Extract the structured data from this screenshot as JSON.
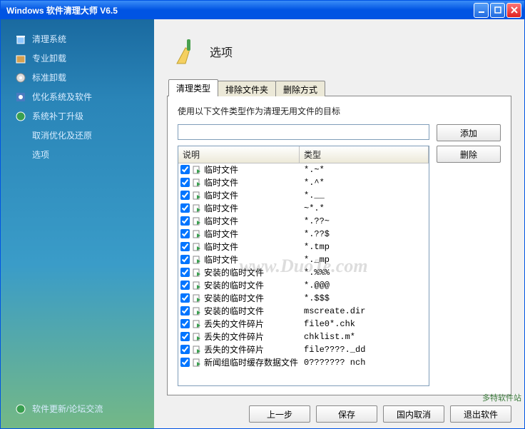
{
  "window": {
    "title": "Windows 软件清理大师 V6.5"
  },
  "sidebar": {
    "items": [
      {
        "label": "清理系统",
        "icon": "trash-icon"
      },
      {
        "label": "专业卸载",
        "icon": "package-icon"
      },
      {
        "label": "标准卸载",
        "icon": "disc-icon"
      },
      {
        "label": "优化系统及软件",
        "icon": "gear-icon"
      },
      {
        "label": "系统补丁升级",
        "icon": "globe-icon"
      },
      {
        "label": "取消优化及还原",
        "icon": ""
      },
      {
        "label": "选项",
        "icon": ""
      }
    ],
    "footer": {
      "label": "软件更新/论坛交流",
      "icon": "globe-icon"
    }
  },
  "page": {
    "title": "选项"
  },
  "tabs": [
    {
      "label": "清理类型",
      "active": true
    },
    {
      "label": "排除文件夹",
      "active": false
    },
    {
      "label": "删除方式",
      "active": false
    }
  ],
  "panel": {
    "description": "使用以下文件类型作为清理无用文件的目标",
    "input_value": "",
    "buttons": {
      "add": "添加",
      "remove": "删除"
    },
    "columns": {
      "desc": "说明",
      "type": "类型"
    },
    "rows": [
      {
        "checked": true,
        "desc": "临时文件",
        "type": "*.~*"
      },
      {
        "checked": true,
        "desc": "临时文件",
        "type": "*.^*"
      },
      {
        "checked": true,
        "desc": "临时文件",
        "type": "*.__"
      },
      {
        "checked": true,
        "desc": "临时文件",
        "type": "~*.*"
      },
      {
        "checked": true,
        "desc": "临时文件",
        "type": "*.??~"
      },
      {
        "checked": true,
        "desc": "临时文件",
        "type": "*.??$"
      },
      {
        "checked": true,
        "desc": "临时文件",
        "type": "*.tmp"
      },
      {
        "checked": true,
        "desc": "临时文件",
        "type": "*._mp"
      },
      {
        "checked": true,
        "desc": "安装的临时文件",
        "type": "*.%%%"
      },
      {
        "checked": true,
        "desc": "安装的临时文件",
        "type": "*.@@@"
      },
      {
        "checked": true,
        "desc": "安装的临时文件",
        "type": "*.$$$"
      },
      {
        "checked": true,
        "desc": "安装的临时文件",
        "type": "mscreate.dir"
      },
      {
        "checked": true,
        "desc": "丢失的文件碎片",
        "type": "file0*.chk"
      },
      {
        "checked": true,
        "desc": "丢失的文件碎片",
        "type": "chklist.m*"
      },
      {
        "checked": true,
        "desc": "丢失的文件碎片",
        "type": "file????._dd"
      },
      {
        "checked": true,
        "desc": "新闻组临时缓存数据文件",
        "type": "0??????? nch"
      }
    ]
  },
  "footer": {
    "prev": "上一步",
    "save": "保存",
    "cancel": "国内取消",
    "exit": "退出软件"
  },
  "watermark": "www.DuoTe.com",
  "corner": {
    "line1": "多特软件站",
    "line2": ""
  }
}
